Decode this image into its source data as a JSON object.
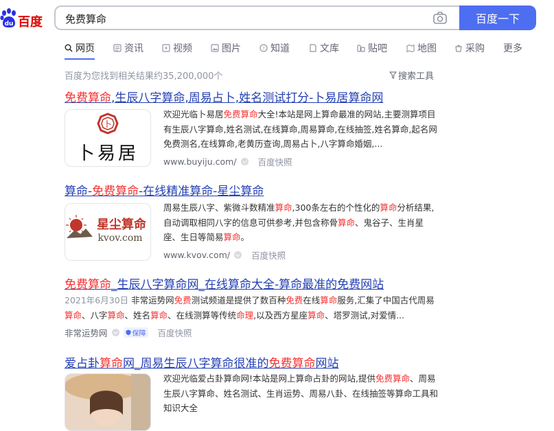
{
  "logo": {
    "paw_text": "du",
    "name": "百度"
  },
  "search": {
    "query": "免费算命",
    "button": "百度一下"
  },
  "tabs": [
    {
      "label": "网页",
      "icon": "search-icon"
    },
    {
      "label": "资讯",
      "icon": "news-icon"
    },
    {
      "label": "视频",
      "icon": "video-icon"
    },
    {
      "label": "图片",
      "icon": "image-icon"
    },
    {
      "label": "知道",
      "icon": "question-icon"
    },
    {
      "label": "文库",
      "icon": "document-icon"
    },
    {
      "label": "贴吧",
      "icon": "tieba-icon"
    },
    {
      "label": "地图",
      "icon": "map-icon"
    },
    {
      "label": "采购",
      "icon": "purchase-icon"
    },
    {
      "label": "更多",
      "icon": ""
    }
  ],
  "result_count": "百度为您找到相关结果约35,200,000个",
  "tools": "搜索工具",
  "results": [
    {
      "title": [
        {
          "t": "免费算命",
          "hl": true
        },
        {
          "t": ",生辰八字算命,周易占卜,姓名测试打分-卜易居算命网",
          "hl": false
        }
      ],
      "thumb_text": "卜易居",
      "abstract": [
        [
          {
            "t": "欢迎光临卜易居",
            "hl": false
          },
          {
            "t": "免费算命",
            "hl": true
          },
          {
            "t": "大全!本站是网上算命最准的网站,主要测算项目",
            "hl": false
          }
        ],
        [
          {
            "t": "有生辰八字算命,姓名测试,在线算命,周易算命,在线抽签,姓名算命,起名网",
            "hl": false
          }
        ],
        [
          {
            "t": "免费测名,在线算命,老黄历查询,周易占卜,八字算命婚姻,...",
            "hl": false
          }
        ]
      ],
      "url": "www.buyiju.com/",
      "snapshot": "百度快照"
    },
    {
      "title": [
        {
          "t": "算命-",
          "hl": false
        },
        {
          "t": "免费算命",
          "hl": true
        },
        {
          "t": "-在线精准算命-星尘算命",
          "hl": false
        }
      ],
      "thumb_text": "星尘算命",
      "thumb_sub": "kvov.com",
      "abstract": [
        [
          {
            "t": "周易生辰八字、紫微斗数精准",
            "hl": false
          },
          {
            "t": "算命",
            "hl": true
          },
          {
            "t": ",300条左右的个性化的",
            "hl": false
          },
          {
            "t": "算命",
            "hl": true
          },
          {
            "t": "分析结果,",
            "hl": false
          }
        ],
        [
          {
            "t": "自动调取相同八字的信息可供参考,并包含称骨",
            "hl": false
          },
          {
            "t": "算命",
            "hl": true
          },
          {
            "t": "、鬼谷子、生肖星",
            "hl": false
          }
        ],
        [
          {
            "t": "座、生日等简易",
            "hl": false
          },
          {
            "t": "算命",
            "hl": true
          },
          {
            "t": "。",
            "hl": false
          }
        ]
      ],
      "url": "www.kvov.com/",
      "snapshot": "百度快照"
    },
    {
      "title": [
        {
          "t": "免费算命",
          "hl": true
        },
        {
          "t": "_生辰八字算命网_在线算命大全-算命最准的免费网站",
          "hl": false
        }
      ],
      "date": "2021年6月30日",
      "abstract": [
        [
          {
            "t": "非常运势网",
            "hl": false
          },
          {
            "t": "免费",
            "hl": true
          },
          {
            "t": "测试频道是提供了数百种",
            "hl": false
          },
          {
            "t": "免费",
            "hl": true
          },
          {
            "t": "在线",
            "hl": false
          },
          {
            "t": "算命",
            "hl": true
          },
          {
            "t": "服务,汇集了中国古代周易",
            "hl": false
          }
        ],
        [
          {
            "t": "算命",
            "hl": true
          },
          {
            "t": "、八字",
            "hl": false
          },
          {
            "t": "算命",
            "hl": true
          },
          {
            "t": "、姓名",
            "hl": false
          },
          {
            "t": "算命",
            "hl": true
          },
          {
            "t": "、在线测算等传统",
            "hl": false
          },
          {
            "t": "命理",
            "hl": true
          },
          {
            "t": ",以及西方星座",
            "hl": false
          },
          {
            "t": "算命",
            "hl": true
          },
          {
            "t": "、塔罗测试,对爱情...",
            "hl": false
          }
        ]
      ],
      "url": "非常运势网",
      "badge": "保障",
      "snapshot": "百度快照"
    },
    {
      "title": [
        {
          "t": "爱占卦",
          "hl": false
        },
        {
          "t": "算命",
          "hl": true
        },
        {
          "t": "网_周易生辰八字算命很准的",
          "hl": false
        },
        {
          "t": "免费算命",
          "hl": true
        },
        {
          "t": "网站",
          "hl": false
        }
      ],
      "abstract": [
        [
          {
            "t": "欢迎光临爱占卦算命网!本站是网上算命占卦的网站,提供",
            "hl": false
          },
          {
            "t": "免费算命",
            "hl": true
          },
          {
            "t": "、周易",
            "hl": false
          }
        ],
        [
          {
            "t": "生辰八字算命、姓名测试、生肖运势、周易八卦、在线抽签等算命工具和",
            "hl": false
          }
        ],
        [
          {
            "t": "知识大全",
            "hl": false
          }
        ]
      ]
    }
  ]
}
